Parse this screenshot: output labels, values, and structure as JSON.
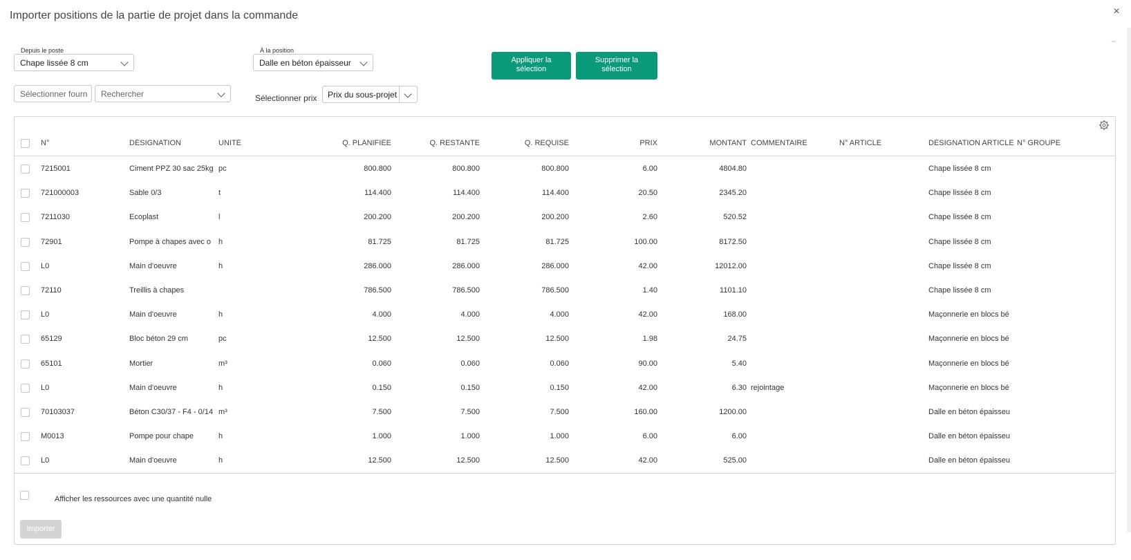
{
  "dialog": {
    "title": "Importer positions de la partie de projet dans la commande",
    "close_glyph": "×",
    "minimize_glyph": "–"
  },
  "from_post": {
    "label": "Depuis le poste",
    "value": "Chape lissée 8 cm"
  },
  "to_position": {
    "label": "À la position",
    "value": "Dalle en béton épaisseur"
  },
  "apply_btn": {
    "line1": "Appliquer la",
    "line2": "sélection"
  },
  "delete_btn": {
    "line1": "Supprimer la",
    "line2": "sélection"
  },
  "supplier": {
    "placeholder": "Sélectionner fourn"
  },
  "search": {
    "placeholder": "Rechercher"
  },
  "price": {
    "label": "Sélectionner prix",
    "value": "Prix du sous-projet"
  },
  "table": {
    "columns": [
      "N°",
      "DÉSIGNATION",
      "UNITÉ",
      "Q. PLANIFIÉE",
      "Q. RESTANTE",
      "Q. REQUISE",
      "PRIX",
      "MONTANT",
      "COMMENTAIRE",
      "N° ARTICLE",
      "DÉSIGNATION ARTICLE",
      "N° GROUPE"
    ],
    "rows": [
      [
        "7215001",
        "Ciment PPZ 30 sac 25kg",
        "pc",
        "800.800",
        "800.800",
        "800.800",
        "6.00",
        "4804.80",
        "",
        "",
        "Chape lissée 8 cm",
        ""
      ],
      [
        "721000003",
        "Sable 0/3",
        "t",
        "114.400",
        "114.400",
        "114.400",
        "20.50",
        "2345.20",
        "",
        "",
        "Chape lissée 8 cm",
        ""
      ],
      [
        "7211030",
        "Ecoplast",
        "l",
        "200.200",
        "200.200",
        "200.200",
        "2.60",
        "520.52",
        "",
        "",
        "Chape lissée 8 cm",
        ""
      ],
      [
        "72901",
        "Pompe à chapes avec o",
        "h",
        "81.725",
        "81.725",
        "81.725",
        "100.00",
        "8172.50",
        "",
        "",
        "Chape lissée 8 cm",
        ""
      ],
      [
        "L0",
        "Main d'oeuvre",
        "h",
        "286.000",
        "286.000",
        "286.000",
        "42.00",
        "12012.00",
        "",
        "",
        "Chape lissée 8 cm",
        ""
      ],
      [
        "72110",
        "Treillis à chapes",
        "",
        "786.500",
        "786.500",
        "786.500",
        "1.40",
        "1101.10",
        "",
        "",
        "Chape lissée 8 cm",
        ""
      ],
      [
        "L0",
        "Main d'oeuvre",
        "h",
        "4.000",
        "4.000",
        "4.000",
        "42.00",
        "168.00",
        "",
        "",
        "Maçonnerie en blocs bé",
        ""
      ],
      [
        "65129",
        "Bloc béton 29 cm",
        "pc",
        "12.500",
        "12.500",
        "12.500",
        "1.98",
        "24.75",
        "",
        "",
        "Maçonnerie en blocs bé",
        ""
      ],
      [
        "65101",
        "Mortier",
        "m³",
        "0.060",
        "0.060",
        "0.060",
        "90.00",
        "5.40",
        "",
        "",
        "Maçonnerie en blocs bé",
        ""
      ],
      [
        "L0",
        "Main d'oeuvre",
        "h",
        "0.150",
        "0.150",
        "0.150",
        "42.00",
        "6.30",
        "rejointage",
        "",
        "Maçonnerie en blocs bé",
        ""
      ],
      [
        "70103037",
        "Béton C30/37 - F4 - 0/14",
        "m³",
        "7.500",
        "7.500",
        "7.500",
        "160.00",
        "1200.00",
        "",
        "",
        "Dalle en béton épaisseu",
        ""
      ],
      [
        "M0013",
        "Pompe pour chape",
        "h",
        "1.000",
        "1.000",
        "1.000",
        "6.00",
        "6.00",
        "",
        "",
        "Dalle en béton épaisseu",
        ""
      ],
      [
        "L0",
        "Main d'oeuvre",
        "h",
        "12.500",
        "12.500",
        "12.500",
        "42.00",
        "525.00",
        "",
        "",
        "Dalle en béton épaisseu",
        ""
      ]
    ]
  },
  "footer": {
    "zero_qty_label": "Afficher les ressources avec une quantité nulle",
    "import_label": "Importer"
  },
  "colors": {
    "accent": "#0a9a7a",
    "disabled": "#d4d4d4",
    "border": "#d6d6d6"
  },
  "icons": {
    "close": "close-icon",
    "gear": "gear-icon",
    "chevron": "chevron-down-icon"
  }
}
